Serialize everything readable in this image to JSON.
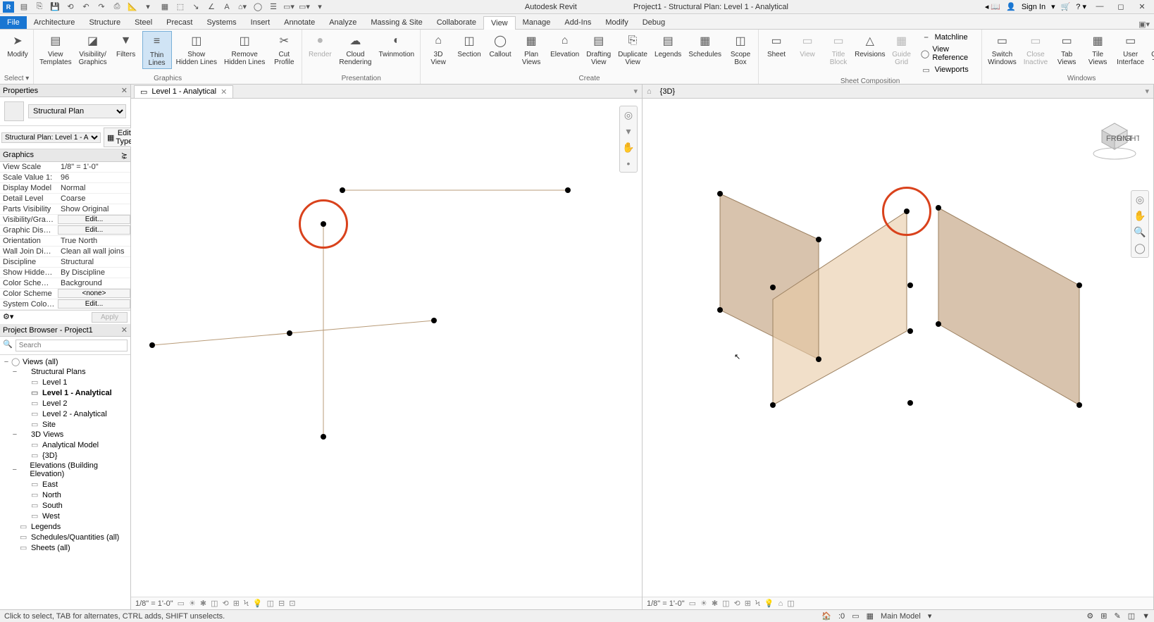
{
  "title_center": "Autodesk Revit",
  "title_project": "Project1 - Structural Plan: Level 1 - Analytical",
  "signin": "Sign In",
  "ribbon_tabs": [
    "File",
    "Architecture",
    "Structure",
    "Steel",
    "Precast",
    "Systems",
    "Insert",
    "Annotate",
    "Analyze",
    "Massing & Site",
    "Collaborate",
    "View",
    "Manage",
    "Add-Ins",
    "Modify",
    "Debug"
  ],
  "active_tab": "View",
  "ribbon": {
    "select": "Select ▾",
    "modify": "Modify",
    "groups": {
      "graphics": {
        "label": "Graphics",
        "view_templates": "View\nTemplates",
        "visibility": "Visibility/\nGraphics",
        "filters": "Filters",
        "thin_lines": "Thin\nLines",
        "show_hidden": "Show\nHidden Lines",
        "remove_hidden": "Remove\nHidden Lines",
        "cut_profile": "Cut\nProfile"
      },
      "presentation": {
        "label": "Presentation",
        "render": "Render",
        "cloud": "Cloud\nRendering",
        "twinmotion": "Twinmotion"
      },
      "create": {
        "label": "Create",
        "_3d": "3D\nView",
        "section": "Section",
        "callout": "Callout",
        "plan": "Plan\nViews",
        "elevation": "Elevation",
        "drafting": "Drafting\nView",
        "duplicate": "Duplicate\nView",
        "legends": "Legends",
        "schedules": "Schedules",
        "scope": "Scope\nBox"
      },
      "sheet": {
        "label": "Sheet Composition",
        "sheet": "Sheet",
        "view": "View",
        "title": "Title\nBlock",
        "revisions": "Revisions",
        "guide": "Guide\nGrid",
        "matchline": "Matchline",
        "viewref": "View Reference",
        "viewports": "Viewports"
      },
      "windows": {
        "label": "Windows",
        "switch": "Switch\nWindows",
        "close": "Close\nInactive",
        "tab": "Tab\nViews",
        "tile": "Tile\nViews",
        "ui": "User\nInterface",
        "theme": "Canvas\nTheme"
      }
    }
  },
  "properties": {
    "title": "Properties",
    "type": "Structural Plan",
    "selector": "Structural Plan: Level 1 - A",
    "edit_type": "Edit Type",
    "section": "Graphics",
    "rows": [
      {
        "k": "View Scale",
        "v": "1/8\" = 1'-0\""
      },
      {
        "k": "Scale Value   1:",
        "v": "96",
        "faded": true
      },
      {
        "k": "Display Model",
        "v": "Normal"
      },
      {
        "k": "Detail Level",
        "v": "Coarse"
      },
      {
        "k": "Parts Visibility",
        "v": "Show Original"
      },
      {
        "k": "Visibility/Graph...",
        "btn": "Edit..."
      },
      {
        "k": "Graphic Display...",
        "btn": "Edit..."
      },
      {
        "k": "Orientation",
        "v": "True North"
      },
      {
        "k": "Wall Join Display",
        "v": "Clean all wall joins"
      },
      {
        "k": "Discipline",
        "v": "Structural"
      },
      {
        "k": "Show Hidden L...",
        "v": "By Discipline"
      },
      {
        "k": "Color Scheme ...",
        "v": "Background"
      },
      {
        "k": "Color Scheme",
        "btn": "<none>"
      },
      {
        "k": "System Color S...",
        "btn": "Edit..."
      }
    ],
    "apply": "Apply"
  },
  "browser": {
    "title": "Project Browser - Project1",
    "search_ph": "Search",
    "tree": [
      {
        "l": 0,
        "tw": "−",
        "t": "Views (all)",
        "ico": "◯"
      },
      {
        "l": 1,
        "tw": "−",
        "t": "Structural Plans"
      },
      {
        "l": 2,
        "t": "Level 1",
        "ico": "▭"
      },
      {
        "l": 2,
        "t": "Level 1 - Analytical",
        "ico": "▭",
        "bold": true
      },
      {
        "l": 2,
        "t": "Level 2",
        "ico": "▭"
      },
      {
        "l": 2,
        "t": "Level 2 - Analytical",
        "ico": "▭"
      },
      {
        "l": 2,
        "t": "Site",
        "ico": "▭"
      },
      {
        "l": 1,
        "tw": "−",
        "t": "3D Views"
      },
      {
        "l": 2,
        "t": "Analytical Model",
        "ico": "▭"
      },
      {
        "l": 2,
        "t": "{3D}",
        "ico": "▭"
      },
      {
        "l": 1,
        "tw": "−",
        "t": "Elevations (Building Elevation)"
      },
      {
        "l": 2,
        "t": "East",
        "ico": "▭"
      },
      {
        "l": 2,
        "t": "North",
        "ico": "▭"
      },
      {
        "l": 2,
        "t": "South",
        "ico": "▭"
      },
      {
        "l": 2,
        "t": "West",
        "ico": "▭"
      },
      {
        "l": 1,
        "t": "Legends",
        "ico": "▭"
      },
      {
        "l": 1,
        "t": "Schedules/Quantities (all)",
        "ico": "▭"
      },
      {
        "l": 1,
        "t": "Sheets (all)",
        "ico": "▭"
      }
    ]
  },
  "vp_left": {
    "tab": "Level 1 - Analytical",
    "scale": "1/8\" = 1'-0\""
  },
  "vp_right": {
    "tab": "{3D}",
    "scale": "1/8\" = 1'-0\""
  },
  "status": {
    "hint": "Click to select, TAB for alternates, CTRL adds, SHIFT unselects.",
    "sel": ":0",
    "model": "Main Model"
  }
}
